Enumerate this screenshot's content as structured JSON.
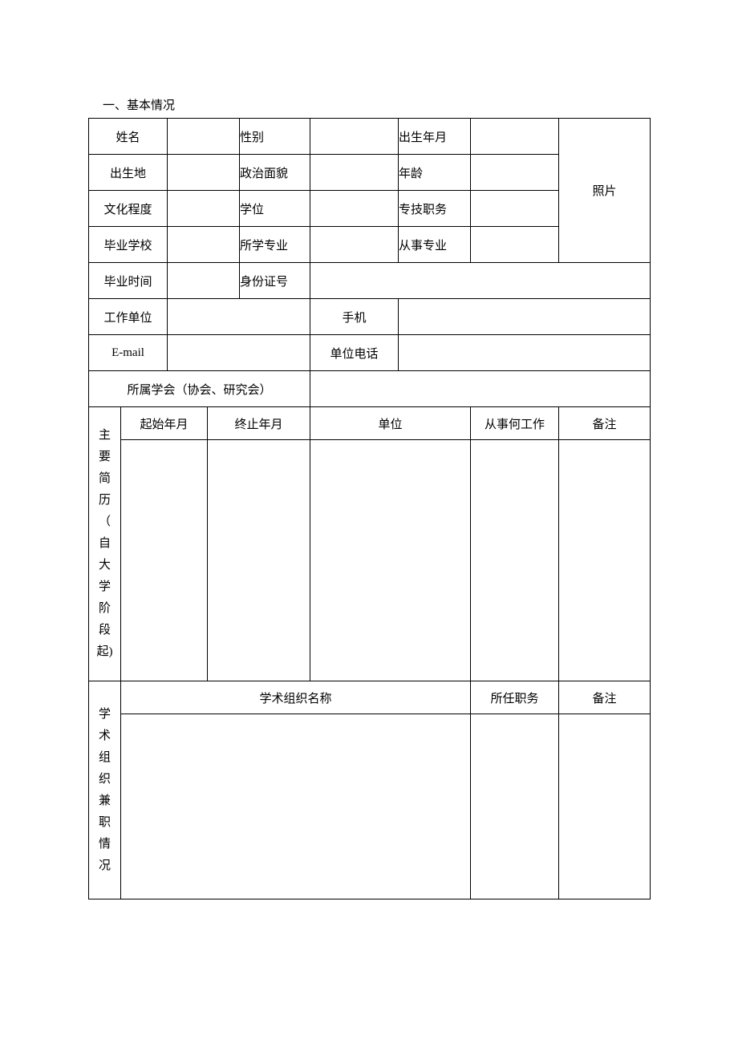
{
  "sectionTitle": "一、基本情况",
  "labels": {
    "name": "姓名",
    "gender": "性别",
    "birthDate": "出生年月",
    "birthPlace": "出生地",
    "politicalStatus": "政治面貌",
    "age": "年龄",
    "education": "文化程度",
    "degree": "学位",
    "proTitle": "专技职务",
    "gradSchool": "毕业学校",
    "major": "所学专业",
    "engagedMajor": "从事专业",
    "gradTime": "毕业时间",
    "idNumber": "身份证号",
    "workUnit": "工作单位",
    "mobile": "手机",
    "email": "E-mail",
    "unitPhone": "单位电话",
    "society": "所属学会（协会、研究会）",
    "photo": "照片"
  },
  "values": {
    "name": "",
    "gender": "",
    "birthDate": "",
    "birthPlace": "",
    "politicalStatus": "",
    "age": "",
    "education": "",
    "degree": "",
    "proTitle": "",
    "gradSchool": "",
    "major": "",
    "engagedMajor": "",
    "gradTime": "",
    "idNumber": "",
    "workUnit": "",
    "mobile": "",
    "email": "",
    "unitPhone": "",
    "society": ""
  },
  "resume": {
    "sideLabel": [
      "主",
      "要",
      "简",
      "历",
      "（",
      "自",
      "大",
      "学",
      "阶",
      "段",
      "起)"
    ],
    "headers": {
      "start": "起始年月",
      "end": "终止年月",
      "unit": "单位",
      "work": "从事何工作",
      "note": "备注"
    },
    "rows": [
      {
        "start": "",
        "end": "",
        "unit": "",
        "work": "",
        "note": ""
      }
    ]
  },
  "academicOrg": {
    "sideLabel": [
      "学",
      "术",
      "组",
      "织",
      "兼",
      "职",
      "情",
      "况"
    ],
    "headers": {
      "orgName": "学术组织名称",
      "position": "所任职务",
      "note": "备注"
    },
    "rows": [
      {
        "orgName": "",
        "position": "",
        "note": ""
      }
    ]
  }
}
